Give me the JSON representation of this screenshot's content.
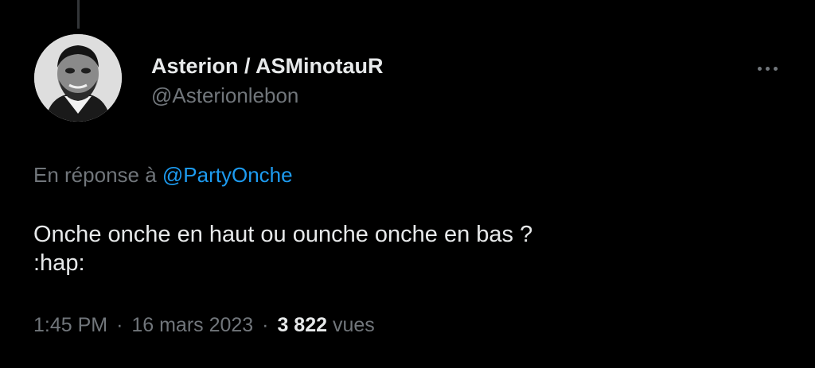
{
  "author": {
    "display_name": "Asterion / ASMinotauR",
    "handle": "@Asterionlebon",
    "avatar_icon": "avatar-photo"
  },
  "reply": {
    "prefix": "En réponse à",
    "mention": "@PartyOnche"
  },
  "tweet": {
    "line1": "Onche onche en haut ou ounche onche en bas ?",
    "line2": ":hap:"
  },
  "meta": {
    "time": "1:45 PM",
    "separator": "·",
    "date": "16 mars 2023",
    "views_count": "3 822",
    "views_label": "vues"
  },
  "more_icon": "more-horizontal-icon",
  "colors": {
    "background": "#000000",
    "text_primary": "#e7e9ea",
    "text_secondary": "#71767b",
    "link": "#1d9bf0"
  }
}
